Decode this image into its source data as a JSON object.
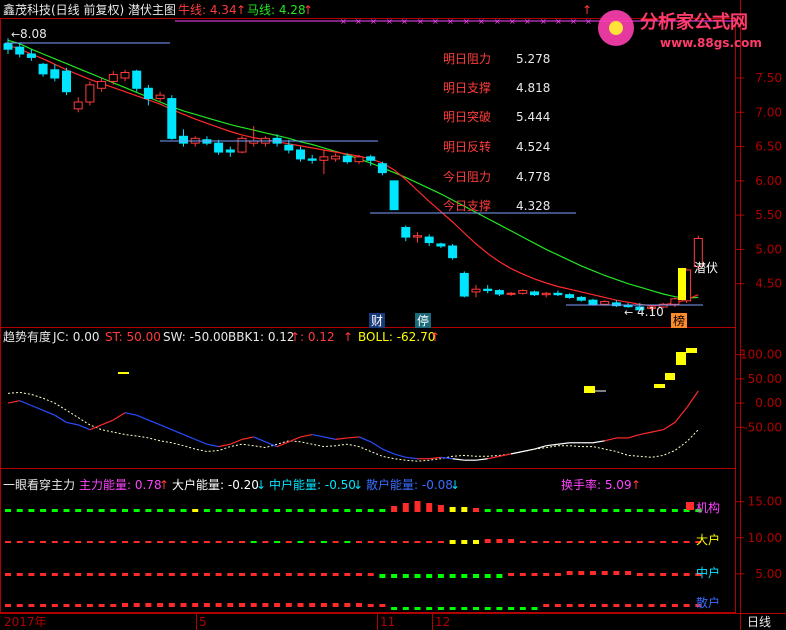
{
  "colors": {
    "up": "#ff3b3b",
    "down": "#00e5ff",
    "ma_fast": "#ff2a2a",
    "ma_slow": "#22e622",
    "axis": "#b00000",
    "text_white": "#e8e8e8",
    "cyan": "#00e5ff",
    "yellow": "#ffff00",
    "magenta": "#ff44ff",
    "green": "#00ff00"
  },
  "header": {
    "title": "鑫茂科技(日线 前复权) 潜伏主图",
    "bull_label": "牛线: 4.34",
    "horse_label": "马线: 4.28",
    "logo_cn": "分析家公式网",
    "logo_url": "www.88gs.com"
  },
  "levels": [
    {
      "label": "明日阻力",
      "value": "5.278"
    },
    {
      "label": "明日支撑",
      "value": "4.818"
    },
    {
      "label": "明日突破",
      "value": "5.444"
    },
    {
      "label": "明日反转",
      "value": "4.524"
    },
    {
      "label": "今日阻力",
      "value": "4.778"
    },
    {
      "label": "今日支撑",
      "value": "4.328"
    }
  ],
  "markers": {
    "high": "8.08",
    "low": "4.10",
    "cai": "财",
    "ting": "停",
    "bang": "榜",
    "qianfu": "潜伏"
  },
  "mid_header": {
    "title": "趋势有度",
    "jc": "JC: 0.00",
    "st": "ST: 50.00",
    "sw": "SW: -50.00",
    "bbk1": "BBK1: 0.12",
    "v012": ": 0.12",
    "boll": "BOLL: -62.70"
  },
  "bot_header": {
    "title": "一眼看穿主力",
    "zhuli": "主力能量: 0.78",
    "dahu": "大户能量: -0.20",
    "zhonghu": "中户能量: -0.50",
    "sanhu": "散户能量: -0.08",
    "huanshou": "换手率: 5.09"
  },
  "bot_tags": {
    "jigou": "机构",
    "dahu": "大户",
    "zhonghu": "中户",
    "sanhu": "散户"
  },
  "bottom_axis": {
    "labels": [
      "2017年",
      "5",
      "11",
      "12"
    ],
    "right": "日线"
  },
  "chart_data": [
    {
      "type": "candlestick",
      "title": "鑫茂科技(日线 前复权) 潜伏主图",
      "y_ticks": [
        4.5,
        5.0,
        5.5,
        6.0,
        6.5,
        7.0,
        7.5
      ],
      "ylim": [
        4.0,
        8.2
      ],
      "candles": [
        [
          8.0,
          8.08,
          7.85,
          7.92
        ],
        [
          7.95,
          8.02,
          7.8,
          7.85
        ],
        [
          7.85,
          7.92,
          7.75,
          7.8
        ],
        [
          7.7,
          7.72,
          7.52,
          7.56
        ],
        [
          7.62,
          7.7,
          7.45,
          7.5
        ],
        [
          7.6,
          7.65,
          7.25,
          7.3
        ],
        [
          7.05,
          7.22,
          7.0,
          7.15
        ],
        [
          7.15,
          7.45,
          7.1,
          7.4
        ],
        [
          7.35,
          7.5,
          7.3,
          7.45
        ],
        [
          7.45,
          7.6,
          7.4,
          7.55
        ],
        [
          7.5,
          7.62,
          7.45,
          7.58
        ],
        [
          7.6,
          7.62,
          7.3,
          7.35
        ],
        [
          7.35,
          7.4,
          7.1,
          7.2
        ],
        [
          7.2,
          7.3,
          7.15,
          7.25
        ],
        [
          7.2,
          7.25,
          6.6,
          6.62
        ],
        [
          6.65,
          6.75,
          6.5,
          6.55
        ],
        [
          6.55,
          6.65,
          6.5,
          6.62
        ],
        [
          6.6,
          6.65,
          6.52,
          6.55
        ],
        [
          6.55,
          6.6,
          6.38,
          6.42
        ],
        [
          6.45,
          6.5,
          6.35,
          6.42
        ],
        [
          6.42,
          6.65,
          6.4,
          6.62
        ],
        [
          6.55,
          6.8,
          6.5,
          6.58
        ],
        [
          6.55,
          6.65,
          6.5,
          6.62
        ],
        [
          6.62,
          6.68,
          6.5,
          6.55
        ],
        [
          6.52,
          6.6,
          6.4,
          6.45
        ],
        [
          6.45,
          6.5,
          6.28,
          6.32
        ],
        [
          6.32,
          6.38,
          6.25,
          6.3
        ],
        [
          6.3,
          6.45,
          6.1,
          6.35
        ],
        [
          6.32,
          6.4,
          6.28,
          6.36
        ],
        [
          6.36,
          6.4,
          6.25,
          6.28
        ],
        [
          6.28,
          6.38,
          6.25,
          6.35
        ],
        [
          6.35,
          6.38,
          6.22,
          6.3
        ],
        [
          6.25,
          6.28,
          6.08,
          6.12
        ],
        [
          6.0,
          6.0,
          5.58,
          5.58
        ],
        [
          5.32,
          5.35,
          5.12,
          5.18
        ],
        [
          5.18,
          5.25,
          5.1,
          5.2
        ],
        [
          5.18,
          5.22,
          5.05,
          5.1
        ],
        [
          5.08,
          5.1,
          5.02,
          5.05
        ],
        [
          5.05,
          5.08,
          4.85,
          4.88
        ],
        [
          4.65,
          4.68,
          4.3,
          4.32
        ],
        [
          4.38,
          4.48,
          4.3,
          4.42
        ],
        [
          4.42,
          4.48,
          4.36,
          4.4
        ],
        [
          4.4,
          4.42,
          4.32,
          4.35
        ],
        [
          4.35,
          4.38,
          4.32,
          4.36
        ],
        [
          4.36,
          4.42,
          4.34,
          4.4
        ],
        [
          4.38,
          4.4,
          4.32,
          4.34
        ],
        [
          4.34,
          4.38,
          4.3,
          4.36
        ],
        [
          4.36,
          4.4,
          4.32,
          4.34
        ],
        [
          4.34,
          4.36,
          4.28,
          4.3
        ],
        [
          4.3,
          4.32,
          4.24,
          4.26
        ],
        [
          4.26,
          4.28,
          4.18,
          4.2
        ],
        [
          4.2,
          4.26,
          4.18,
          4.24
        ],
        [
          4.22,
          4.26,
          4.16,
          4.18
        ],
        [
          4.18,
          4.22,
          4.15,
          4.17
        ],
        [
          4.16,
          4.22,
          4.1,
          4.12
        ],
        [
          4.14,
          4.18,
          4.1,
          4.16
        ],
        [
          4.16,
          4.22,
          4.14,
          4.2
        ],
        [
          4.2,
          4.3,
          4.16,
          4.28
        ],
        [
          4.25,
          4.72,
          4.22,
          4.7
        ],
        [
          4.75,
          5.2,
          4.7,
          5.16
        ]
      ],
      "ma_slow": [
        8.05,
        8.0,
        7.92,
        7.85,
        7.78,
        7.71,
        7.64,
        7.57,
        7.5,
        7.43,
        7.36,
        7.29,
        7.22,
        7.15,
        7.08,
        7.02,
        6.97,
        6.92,
        6.87,
        6.82,
        6.78,
        6.74,
        6.7,
        6.66,
        6.62,
        6.57,
        6.53,
        6.48,
        6.43,
        6.38,
        6.32,
        6.26,
        6.19,
        6.12,
        6.05,
        5.97,
        5.89,
        5.81,
        5.72,
        5.63,
        5.54,
        5.45,
        5.36,
        5.27,
        5.18,
        5.09,
        5.0,
        4.92,
        4.84,
        4.76,
        4.69,
        4.62,
        4.56,
        4.5,
        4.45,
        4.4,
        4.35,
        4.31,
        4.29,
        4.3
      ],
      "ma_fast": [
        7.98,
        7.92,
        7.85,
        7.78,
        7.7,
        7.62,
        7.55,
        7.48,
        7.42,
        7.36,
        7.3,
        7.24,
        7.18,
        7.12,
        7.04,
        6.97,
        6.9,
        6.84,
        6.78,
        6.72,
        6.67,
        6.63,
        6.6,
        6.57,
        6.54,
        6.51,
        6.48,
        6.45,
        6.42,
        6.39,
        6.36,
        6.32,
        6.26,
        6.16,
        6.02,
        5.86,
        5.7,
        5.55,
        5.4,
        5.24,
        5.08,
        4.94,
        4.82,
        4.72,
        4.64,
        4.57,
        4.51,
        4.46,
        4.42,
        4.38,
        4.34,
        4.3,
        4.26,
        4.23,
        4.2,
        4.18,
        4.19,
        4.22,
        4.27,
        4.34
      ]
    },
    {
      "type": "line",
      "title": "趋势有度",
      "y_ticks": [
        100.0,
        50.0,
        0.0,
        -50.0
      ],
      "ylim": [
        -130,
        120
      ],
      "series": [
        {
          "name": "",
          "values": [
            0,
            5,
            -5,
            -15,
            -25,
            -40,
            -45,
            -55,
            -45,
            -35,
            -20,
            -25,
            -35,
            -45,
            -55,
            -65,
            -75,
            -85,
            -90,
            -85,
            -75,
            -70,
            -80,
            -90,
            -80,
            -70,
            -65,
            -70,
            -75,
            -72,
            -70,
            -80,
            -95,
            -105,
            -112,
            -115,
            -115,
            -112,
            -115,
            -118,
            -118,
            -115,
            -110,
            -105,
            -100,
            -95,
            -88,
            -85,
            -82,
            -82,
            -82,
            -78,
            -72,
            -72,
            -65,
            -60,
            -55,
            -40,
            -10,
            25
          ]
        },
        {
          "name": "",
          "values": [
            20,
            22,
            18,
            10,
            0,
            -15,
            -30,
            -45,
            -55,
            -60,
            -65,
            -68,
            -72,
            -78,
            -82,
            -88,
            -95,
            -100,
            -98,
            -90,
            -85,
            -88,
            -92,
            -85,
            -78,
            -80,
            -85,
            -90,
            -88,
            -85,
            -90,
            -100,
            -110,
            -115,
            -118,
            -120,
            -118,
            -115,
            -110,
            -108,
            -110,
            -110,
            -108,
            -105,
            -100,
            -95,
            -92,
            -88,
            -88,
            -90,
            -90,
            -95,
            -100,
            -108,
            -110,
            -112,
            -108,
            -98,
            -80,
            -55
          ]
        }
      ]
    },
    {
      "type": "bar",
      "title": "一眼看穿主力",
      "y_ticks": [
        15.0,
        10.0,
        5.0
      ],
      "ylim": [
        0,
        18
      ]
    }
  ]
}
